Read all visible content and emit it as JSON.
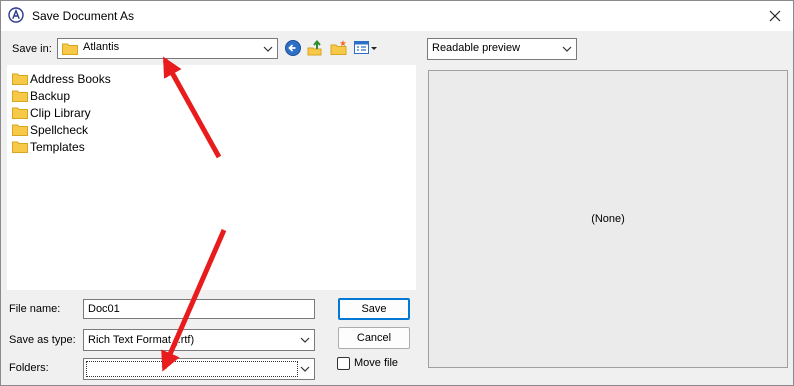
{
  "window": {
    "title": "Save Document As",
    "close_glyph": "✕"
  },
  "save_in": {
    "label": "Save in:",
    "value": "Atlantis"
  },
  "folders": [
    {
      "name": "Address Books"
    },
    {
      "name": "Backup"
    },
    {
      "name": "Clip Library"
    },
    {
      "name": "Spellcheck"
    },
    {
      "name": "Templates"
    }
  ],
  "file_name": {
    "label": "File name:",
    "value": "Doc01"
  },
  "save_as_type": {
    "label": "Save as type:",
    "value": "Rich Text Format (.rtf)"
  },
  "folders_field": {
    "label": "Folders:",
    "value": ""
  },
  "buttons": {
    "save": "Save",
    "cancel": "Cancel"
  },
  "move_file": {
    "label": "Move file",
    "checked": false
  },
  "preview": {
    "mode": "Readable preview",
    "content": "(None)"
  },
  "colors": {
    "accent": "#0078d4",
    "annotation_arrow": "#e81c1c",
    "folder": "#f7c948"
  }
}
